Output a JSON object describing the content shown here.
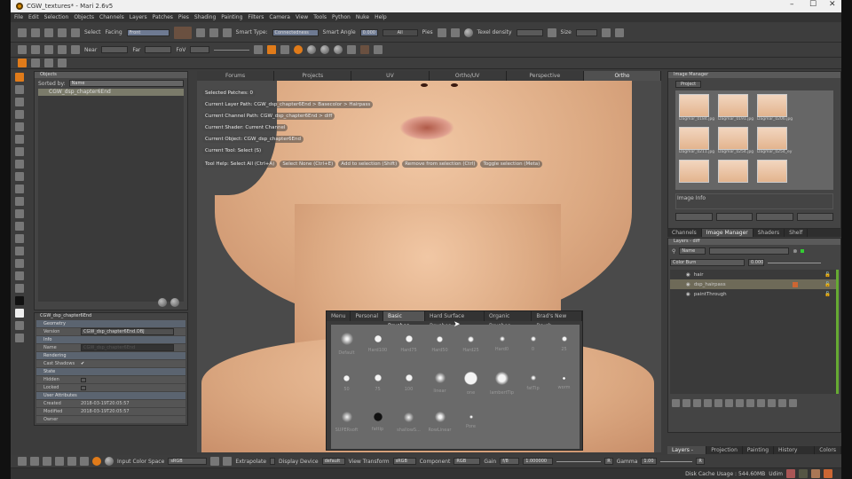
{
  "window": {
    "title": "CGW_textures* - Mari 2.6v5",
    "min": "–",
    "max": "☐",
    "close": "✕"
  },
  "menu": [
    "File",
    "Edit",
    "Selection",
    "Objects",
    "Channels",
    "Layers",
    "Patches",
    "Pies",
    "Shading",
    "Painting",
    "Filters",
    "Camera",
    "View",
    "Tools",
    "Python",
    "Nuke",
    "Help"
  ],
  "toolbar": {
    "select": "Select",
    "facing_label": "Facing",
    "facing_value": "Front",
    "smart_type_label": "Smart Type:",
    "smart_type_value": "Connectedness",
    "smart_angle_label": "Smart Angle",
    "smart_angle_value": "0.000",
    "all": "All",
    "pies_label": "Pies",
    "texel_label": "Texel density",
    "size_label": "Size",
    "near_label": "Near",
    "far_label": "Far",
    "fov_label": "FoV"
  },
  "objects": {
    "title": "Objects",
    "sorted_by_label": "Sorted by:",
    "sorted_by_value": "Name",
    "items": [
      "CGW_dsp_chapter6End"
    ]
  },
  "properties": {
    "title": "CGW_dsp_chapter6End",
    "geometry": "Geometry",
    "version_label": "Version",
    "version_value": "CGW_dsp_chapter6End.OBJ",
    "info": "Info",
    "name_label": "Name",
    "name_value": "CGW_dsp_chapter6End",
    "rendering": "Rendering",
    "cast_shadows": "Cast Shadows",
    "state": "State",
    "hidden": "Hidden",
    "locked": "Locked",
    "user_attributes": "User Attributes",
    "created_label": "Created",
    "created_value": "2018-03-19T20:05:57",
    "modified_label": "Modified",
    "modified_value": "2018-03-19T20:05:57",
    "owner_label": "Owner"
  },
  "viewport": {
    "tabs": [
      "Forums",
      "Projects",
      "UV",
      "Ortho/UV",
      "Perspective",
      "Ortho"
    ],
    "active_tab": "Ortho",
    "hud": [
      "Selected Patches: 0",
      "Current Layer Path: CGW_dsp_chapter6End > Basecolor > Hairpass",
      "Current Channel Path: CGW_dsp_chapter6End > diff",
      "Current Shader: Current Channel",
      "Current Object: CGW_dsp_chapter6End",
      "Current Tool: Select (S)"
    ],
    "tool_help": [
      "Tool Help: Select All (Ctrl+A)",
      "Select None (Ctrl+E)",
      "Add to selection (Shift)",
      "Remove from selection (Ctrl)",
      "Toggle selection (Meta)"
    ]
  },
  "brushes": {
    "tabs": [
      "Menu",
      "Personal",
      "Basic Brushes",
      "Hard Surface Brushes",
      "Organic Brushes",
      "Brad's New Brush"
    ],
    "active_tab": "Basic Brushes",
    "items": [
      {
        "name": "Default",
        "size": 14,
        "soft": 0.8
      },
      {
        "name": "Hard100",
        "size": 8,
        "soft": 0
      },
      {
        "name": "Hard75",
        "size": 8,
        "soft": 0.1
      },
      {
        "name": "Hard50",
        "size": 7,
        "soft": 0.2
      },
      {
        "name": "Hard25",
        "size": 7,
        "soft": 0.4
      },
      {
        "name": "Hard0",
        "size": 6,
        "soft": 0.6
      },
      {
        "name": "0",
        "size": 6,
        "soft": 0.5
      },
      {
        "name": "25",
        "size": 6,
        "soft": 0.3
      },
      {
        "name": "50",
        "size": 7,
        "soft": 0.1
      },
      {
        "name": "75",
        "size": 8,
        "soft": 0.1
      },
      {
        "name": "100",
        "size": 8,
        "soft": 0.1
      },
      {
        "name": "linear",
        "size": 12,
        "soft": 0.8
      },
      {
        "name": "one",
        "size": 15,
        "soft": 0
      },
      {
        "name": "lambertTip",
        "size": 15,
        "soft": 0.4
      },
      {
        "name": "fatTip",
        "size": 6,
        "soft": 0.6
      },
      {
        "name": "worm",
        "size": 3,
        "soft": 0
      },
      {
        "name": "SUPERsoft",
        "size": 12,
        "soft": 1
      },
      {
        "name": "fattip",
        "size": 10,
        "soft": 0,
        "dark": true
      },
      {
        "name": "shallowS...",
        "size": 11,
        "soft": 1
      },
      {
        "name": "RowLinear",
        "size": 12,
        "soft": 0.7
      },
      {
        "name": "Pore",
        "size": 4,
        "soft": 0.5
      }
    ]
  },
  "image_manager": {
    "title": "Image Manager",
    "tab": "Project",
    "images": [
      "Dagmar_0184.jpg",
      "Dagmar_0191.jpg",
      "Dagmar_0206.jpg",
      "Dagmar_0211.jpg",
      "Dagmar_0254.jpg",
      "Dagmar_0254_ey",
      "",
      "",
      ""
    ],
    "info_label": "Image Info"
  },
  "right_tabs": [
    "Channels",
    "Image Manager",
    "Shaders",
    "Shelf"
  ],
  "right_tabs_active": "Image Manager",
  "layers": {
    "title": "Layers - diff",
    "filter_value": "Name",
    "blend_mode": "Color Burn",
    "opacity": "0.000",
    "items": [
      "hair",
      "dsp_hairpass",
      "paintThrough"
    ],
    "selected": "dsp_hairpass"
  },
  "bottom_right_tabs": [
    "Layers - diff",
    "Projection",
    "Painting",
    "History View",
    "Colors"
  ],
  "bottom_bar": {
    "input_cs_label": "Input Color Space",
    "input_cs_value": "sRGB",
    "extrapolate": "Extrapolate",
    "display_device_label": "Display Device",
    "display_device_value": "default",
    "view_transform_label": "View Transform",
    "view_transform_value": "sRGB",
    "component_label": "Component",
    "component_value": "RGB",
    "gain_label": "Gain",
    "gain_value": "f/8",
    "gain_number": "1.000000",
    "gamma_label": "Gamma",
    "gamma_value": "1.00",
    "reset": "R"
  },
  "status": {
    "disk_cache": "Disk Cache Usage : 544.60MB",
    "udim": "Udim"
  },
  "colors": {
    "accent": "#e07b1a",
    "selection": "#6e7a92",
    "skin": "#dba881",
    "panel": "#444444"
  }
}
